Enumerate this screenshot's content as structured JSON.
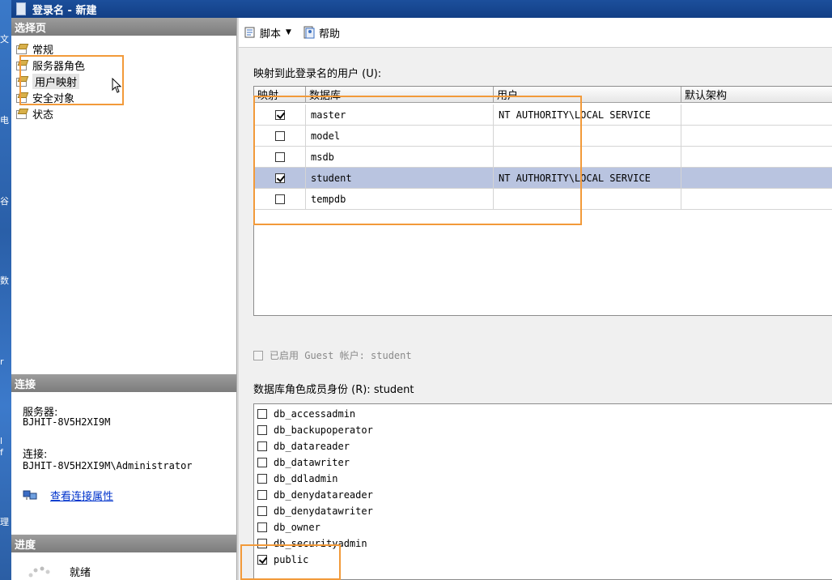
{
  "window": {
    "title": "登录名 - 新建"
  },
  "desktop_chars": [
    "文",
    "电",
    "谷",
    "数",
    "r",
    "l",
    "f",
    "理"
  ],
  "left": {
    "select_page_header": "选择页",
    "pages": [
      {
        "label": "常规",
        "name": "page-general"
      },
      {
        "label": "服务器角色",
        "name": "page-server-roles"
      },
      {
        "label": "用户映射",
        "name": "page-user-mapping",
        "selected": true
      },
      {
        "label": "安全对象",
        "name": "page-securables"
      },
      {
        "label": "状态",
        "name": "page-status"
      }
    ],
    "connection_header": "连接",
    "server_label": "服务器:",
    "server_value": "BJHIT-8V5H2XI9M",
    "connection_label": "连接:",
    "connection_value": "BJHIT-8V5H2XI9M\\Administrator",
    "view_connection_link": "查看连接属性",
    "progress_header": "进度",
    "progress_status": "就绪"
  },
  "toolbar": {
    "script_label": "脚本",
    "help_label": "帮助"
  },
  "mapping": {
    "label": "映射到此登录名的用户 (U):",
    "columns": [
      "映射",
      "数据库",
      "用户",
      "默认架构"
    ],
    "rows": [
      {
        "mapped": true,
        "database": "master",
        "user": "NT AUTHORITY\\LOCAL SERVICE",
        "schema": ""
      },
      {
        "mapped": false,
        "database": "model",
        "user": "",
        "schema": ""
      },
      {
        "mapped": false,
        "database": "msdb",
        "user": "",
        "schema": ""
      },
      {
        "mapped": true,
        "database": "student",
        "user": "NT AUTHORITY\\LOCAL SERVICE",
        "schema": "",
        "selected": true
      },
      {
        "mapped": false,
        "database": "tempdb",
        "user": "",
        "schema": ""
      }
    ]
  },
  "guest": {
    "label": "已启用 Guest 帐户: student",
    "enabled": false
  },
  "roles": {
    "label": "数据库角色成员身份 (R): student",
    "items": [
      {
        "name": "db_accessadmin",
        "checked": false
      },
      {
        "name": "db_backupoperator",
        "checked": false
      },
      {
        "name": "db_datareader",
        "checked": false
      },
      {
        "name": "db_datawriter",
        "checked": false
      },
      {
        "name": "db_ddladmin",
        "checked": false
      },
      {
        "name": "db_denydatareader",
        "checked": false
      },
      {
        "name": "db_denydatawriter",
        "checked": false
      },
      {
        "name": "db_owner",
        "checked": false
      },
      {
        "name": "db_securityadmin",
        "checked": false
      },
      {
        "name": "public",
        "checked": true
      }
    ]
  },
  "colors": {
    "highlight_frame": "#f29a3a",
    "selected_row": "#b9c4e0",
    "link": "#0033cc"
  }
}
